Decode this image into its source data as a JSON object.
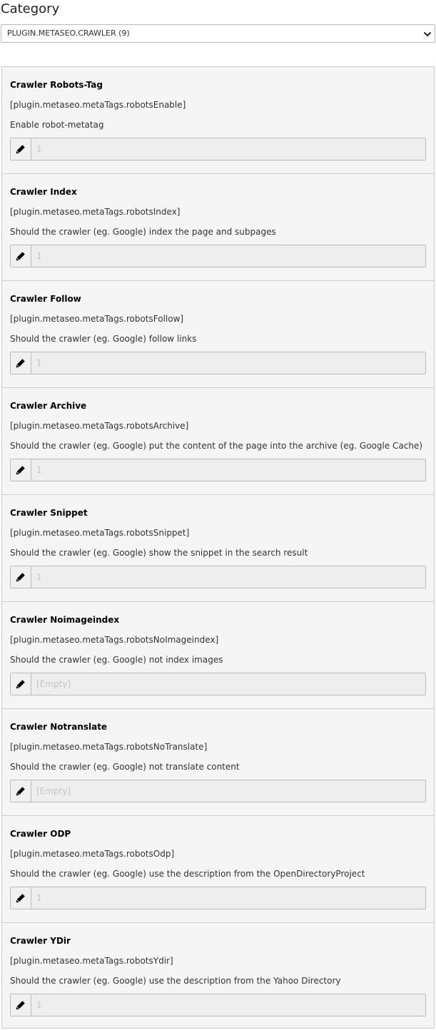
{
  "category": {
    "heading": "Category",
    "selected": "PLUGIN.METASEO.CRAWLER (9)"
  },
  "icons": {
    "select_arrow": "chevron-down-icon",
    "edit": "pencil-icon"
  },
  "colors": {
    "panel_background": "#f5f5f5",
    "field_background": "#eeeeee",
    "border": "#cccccc",
    "placeholder_text": "#c4c4c4"
  },
  "items": [
    {
      "title": "Crawler Robots-Tag",
      "key": "[plugin.metaseo.metaTags.robotsEnable]",
      "description": "Enable robot-metatag",
      "value": "1"
    },
    {
      "title": "Crawler Index",
      "key": "[plugin.metaseo.metaTags.robotsIndex]",
      "description": "Should the crawler (eg. Google) index the page and subpages",
      "value": "1"
    },
    {
      "title": "Crawler Follow",
      "key": "[plugin.metaseo.metaTags.robotsFollow]",
      "description": "Should the crawler (eg. Google) follow links",
      "value": "1"
    },
    {
      "title": "Crawler Archive",
      "key": "[plugin.metaseo.metaTags.robotsArchive]",
      "description": "Should the crawler (eg. Google) put the content of the page into the archive (eg. Google Cache)",
      "value": "1"
    },
    {
      "title": "Crawler Snippet",
      "key": "[plugin.metaseo.metaTags.robotsSnippet]",
      "description": "Should the crawler (eg. Google) show the snippet in the search result",
      "value": "1"
    },
    {
      "title": "Crawler Noimageindex",
      "key": "[plugin.metaseo.metaTags.robotsNoImageindex]",
      "description": "Should the crawler (eg. Google) not index images",
      "value": "[Empty]"
    },
    {
      "title": "Crawler Notranslate",
      "key": "[plugin.metaseo.metaTags.robotsNoTranslate]",
      "description": "Should the crawler (eg. Google) not translate content",
      "value": "[Empty]"
    },
    {
      "title": "Crawler ODP",
      "key": "[plugin.metaseo.metaTags.robotsOdp]",
      "description": "Should the crawler (eg. Google) use the description from the OpenDirectoryProject",
      "value": "1"
    },
    {
      "title": "Crawler YDir",
      "key": "[plugin.metaseo.metaTags.robotsYdir]",
      "description": "Should the crawler (eg. Google) use the description from the Yahoo Directory",
      "value": "1"
    }
  ]
}
